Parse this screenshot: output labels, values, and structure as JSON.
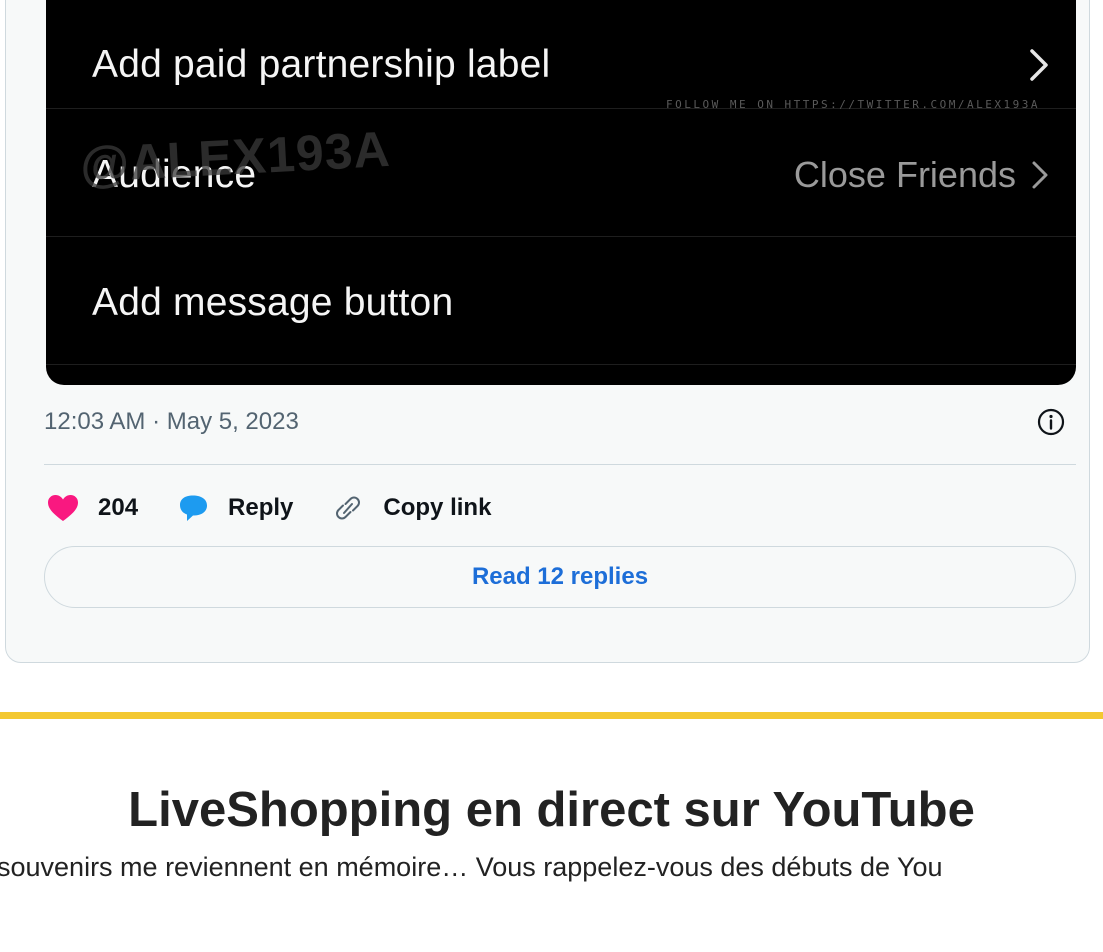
{
  "tweet": {
    "media": {
      "rows": [
        {
          "label": "Add paid partnership label",
          "value": ""
        },
        {
          "label": "Audience",
          "value": "Close Friends"
        },
        {
          "label": "Add message button",
          "value": ""
        }
      ],
      "watermark_follow": "FOLLOW ME ON HTTPS://TWITTER.COM/ALEX193A",
      "watermark_handle": "@ALEX193A"
    },
    "timestamp": "12:03 AM · May 5, 2023",
    "actions": {
      "like_count": "204",
      "reply_label": "Reply",
      "copy_link_label": "Copy link"
    },
    "read_replies_label": "Read 12 replies"
  },
  "colors": {
    "accent_line": "#f3c831",
    "like_heart": "#f91880",
    "reply_bubble": "#1d9bf0",
    "link_blue": "#1d6ed8"
  },
  "icons": [
    "chevron-right-icon",
    "info-icon",
    "heart-icon",
    "reply-bubble-icon",
    "link-icon"
  ],
  "article": {
    "title": "LiveShopping en direct sur YouTube",
    "text": "souvenirs me reviennent en mémoire… Vous rappelez-vous des débuts de You"
  }
}
